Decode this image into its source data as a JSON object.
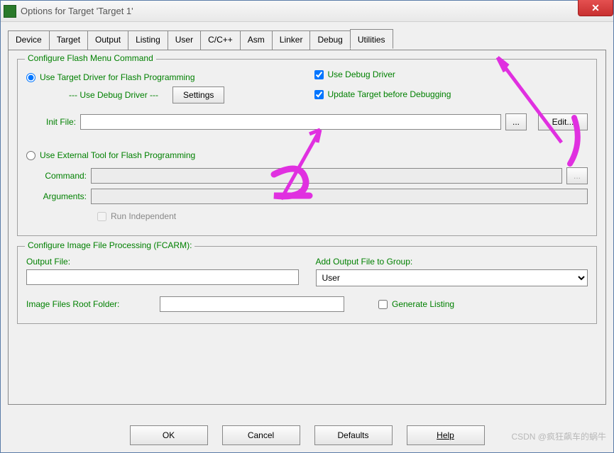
{
  "window": {
    "title": "Options for Target 'Target 1'"
  },
  "tabs": [
    {
      "label": "Device"
    },
    {
      "label": "Target"
    },
    {
      "label": "Output"
    },
    {
      "label": "Listing"
    },
    {
      "label": "User"
    },
    {
      "label": "C/C++"
    },
    {
      "label": "Asm"
    },
    {
      "label": "Linker"
    },
    {
      "label": "Debug"
    },
    {
      "label": "Utilities"
    }
  ],
  "flash": {
    "group_title": "Configure Flash Menu Command",
    "radio_target": "Use Target Driver for Flash Programming",
    "sub_driver": "--- Use Debug Driver ---",
    "settings_btn": "Settings",
    "use_debug_driver": "Use Debug Driver",
    "update_target": "Update Target before Debugging",
    "init_file_label": "Init File:",
    "init_file_value": "",
    "browse_btn": "...",
    "edit_btn": "Edit...",
    "radio_external": "Use External Tool for Flash Programming",
    "command_label": "Command:",
    "command_value": "",
    "command_browse": "...",
    "arguments_label": "Arguments:",
    "arguments_value": "",
    "run_independent": "Run Independent"
  },
  "fcarm": {
    "group_title": "Configure Image File Processing (FCARM):",
    "output_file_label": "Output File:",
    "output_file_value": "",
    "add_output_label": "Add Output File to Group:",
    "group_selected": "User",
    "root_folder_label": "Image Files Root Folder:",
    "root_folder_value": "",
    "generate_listing": "Generate Listing"
  },
  "buttons": {
    "ok": "OK",
    "cancel": "Cancel",
    "defaults": "Defaults",
    "help": "Help"
  },
  "watermark": "CSDN @疯狂飙车的蜗牛"
}
